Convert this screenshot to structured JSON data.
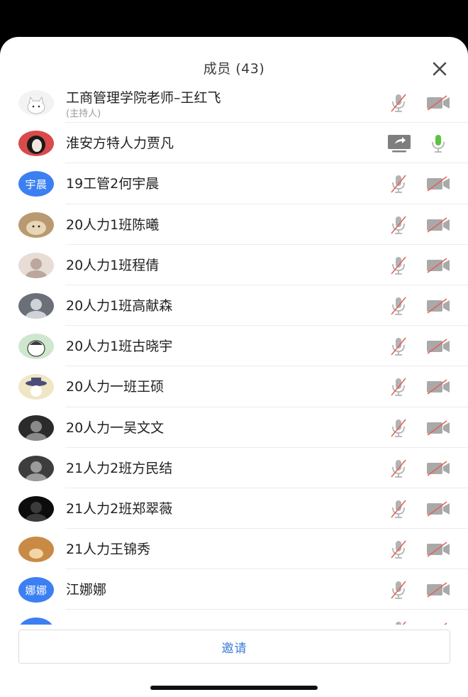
{
  "header": {
    "title": "成员 (43)"
  },
  "members": [
    {
      "name": "工商管理学院老师–王红飞",
      "subtitle": "(主持人)",
      "avatar": {
        "kind": "image",
        "icon": "cat-avatar",
        "colors": [
          "#f3f3f3",
          "#b9b9b9"
        ]
      },
      "mic": "muted",
      "video": "off"
    },
    {
      "name": "淮安方特人力贾凡",
      "avatar": {
        "kind": "image",
        "icon": "girl-avatar",
        "colors": [
          "#d94a4a",
          "#f5e7e0"
        ]
      },
      "mic": "active",
      "video": "screen-share"
    },
    {
      "name": "19工管2何宇晨",
      "avatar": {
        "kind": "text",
        "text": "宇晨"
      },
      "mic": "muted",
      "video": "off"
    },
    {
      "name": "20人力1班陈曦",
      "avatar": {
        "kind": "image",
        "icon": "dog-avatar",
        "colors": [
          "#b99a70",
          "#e7d6b7"
        ]
      },
      "mic": "muted",
      "video": "off"
    },
    {
      "name": "20人力1班程倩",
      "avatar": {
        "kind": "image",
        "icon": "cat-photo-avatar",
        "colors": [
          "#e7dcd6",
          "#bba79b"
        ]
      },
      "mic": "muted",
      "video": "off"
    },
    {
      "name": "20人力1班高献森",
      "avatar": {
        "kind": "image",
        "icon": "person-avatar",
        "colors": [
          "#6a6f78",
          "#cfd3d8"
        ]
      },
      "mic": "muted",
      "video": "off"
    },
    {
      "name": "20人力1班古晓宇",
      "avatar": {
        "kind": "image",
        "icon": "cartoon-avatar",
        "colors": [
          "#cfe7cf",
          "#3a3a3a"
        ]
      },
      "mic": "muted",
      "video": "off"
    },
    {
      "name": "20人力一班王硕",
      "avatar": {
        "kind": "image",
        "icon": "cartoon-hat-avatar",
        "colors": [
          "#f0e6c6",
          "#4a4d7a"
        ]
      },
      "mic": "muted",
      "video": "off"
    },
    {
      "name": "20人力一吴文文",
      "avatar": {
        "kind": "image",
        "icon": "person-avatar",
        "colors": [
          "#2b2b2b",
          "#8a8a8a"
        ]
      },
      "mic": "muted",
      "video": "off"
    },
    {
      "name": "21人力2班方民结",
      "avatar": {
        "kind": "image",
        "icon": "photo-avatar",
        "colors": [
          "#3d3d3d",
          "#9b9b9b"
        ]
      },
      "mic": "muted",
      "video": "off"
    },
    {
      "name": "21人力2班郑翠薇",
      "avatar": {
        "kind": "image",
        "icon": "dark-photo-avatar",
        "colors": [
          "#0c0c0c",
          "#3b3b3b"
        ]
      },
      "mic": "muted",
      "video": "off"
    },
    {
      "name": "21人力王锦秀",
      "avatar": {
        "kind": "image",
        "icon": "bear-avatar",
        "colors": [
          "#c98a45",
          "#f3d6a8"
        ]
      },
      "mic": "muted",
      "video": "off"
    },
    {
      "name": "江娜娜",
      "avatar": {
        "kind": "text",
        "text": "娜娜"
      },
      "mic": "muted",
      "video": "off"
    },
    {
      "name": "",
      "avatar": {
        "kind": "text",
        "text": ""
      },
      "mic": "muted",
      "video": "off"
    }
  ],
  "footer": {
    "invite_label": "邀请"
  },
  "colors": {
    "accent": "#3b7cd8",
    "avatar_blue": "#3c7ff2",
    "mic_active": "#5cc33f",
    "muted_red": "#e0645a",
    "icon_gray": "#9a9a9a"
  }
}
